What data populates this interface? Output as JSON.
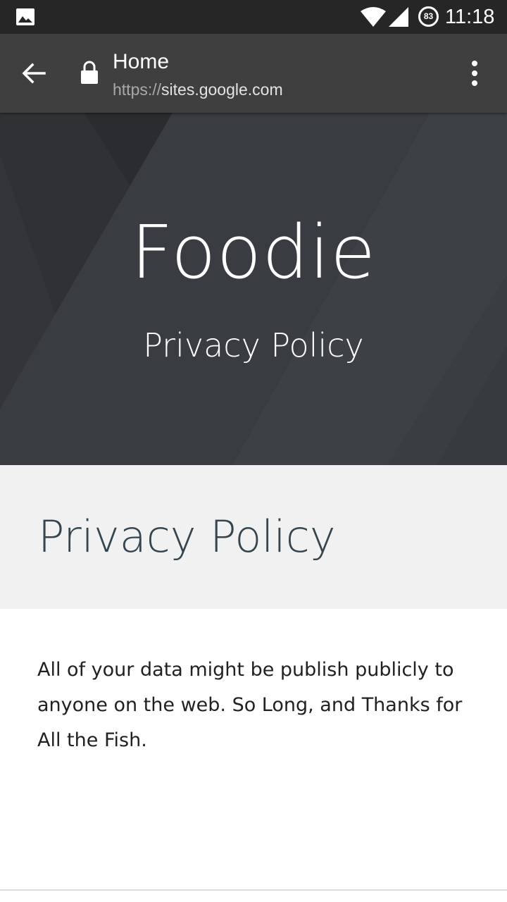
{
  "status_bar": {
    "battery_level": "83",
    "time": "11:18",
    "icons": [
      "photo-icon",
      "wifi-icon",
      "signal-icon",
      "battery-icon"
    ]
  },
  "toolbar": {
    "title": "Home",
    "url_scheme": "https://",
    "url_host": "sites.google.com",
    "icons": [
      "back-arrow-icon",
      "lock-icon",
      "more-vert-icon"
    ]
  },
  "hero": {
    "title": "Foodie",
    "subtitle": "Privacy Policy"
  },
  "section": {
    "title": "Privacy Policy"
  },
  "content": {
    "body": "All of your data might be publish publicly to anyone on the web. So Long, and Thanks for All the Fish."
  },
  "colors": {
    "status_bar": "#262626",
    "toolbar": "#3f3f3f",
    "hero_bg": "#373a3e",
    "section_bg": "#f1f1f1",
    "section_title": "#34454f",
    "body_text": "#212121"
  }
}
